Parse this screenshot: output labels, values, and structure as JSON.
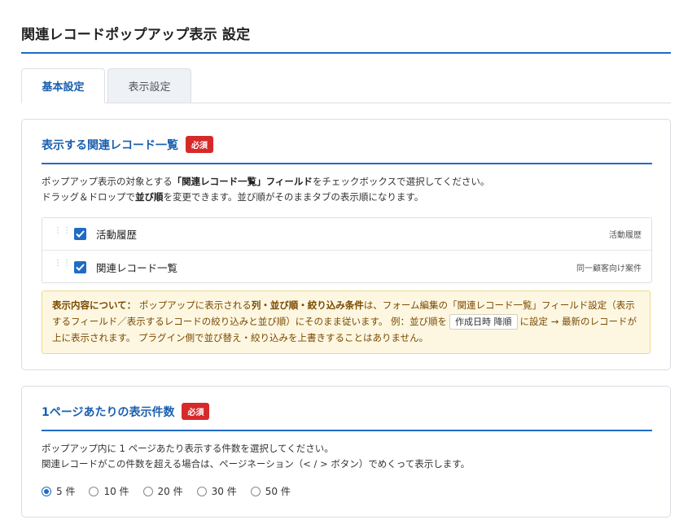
{
  "page": {
    "title": "関連レコードポップアップ表示 設定"
  },
  "tabs": [
    {
      "label": "基本設定",
      "active": true
    },
    {
      "label": "表示設定",
      "active": false
    }
  ],
  "related_list_section": {
    "title": "表示する関連レコード一覧",
    "required_badge": "必須",
    "desc_line1_pre": "ポップアップ表示の対象とする",
    "desc_line1_bold": "「関連レコード一覧」フィールド",
    "desc_line1_post": "をチェックボックスで選択してください。",
    "desc_line2_pre": "ドラッグ＆ドロップで",
    "desc_line2_bold": "並び順",
    "desc_line2_post": "を変更できます。並び順がそのままタブの表示順になります。",
    "fields": [
      {
        "label": "活動履歴",
        "code": "活動履歴",
        "checked": true
      },
      {
        "label": "関連レコード一覧",
        "code": "同一顧客向け案件",
        "checked": true
      }
    ],
    "notice": {
      "heading": "表示内容について：",
      "text1": "ポップアップに表示される",
      "bold1": "列・並び順・絞り込み条件",
      "text2": "は、フォーム編集の「関連レコード一覧」フィールド設定（表示するフィールド／表示するレコードの絞り込みと並び順）にそのまま従います。 例：並び順を",
      "chip": "作成日時 降順",
      "text3": "に設定 → 最新のレコードが上に表示されます。 プラグイン側で並び替え・絞り込みを上書きすることはありません。"
    }
  },
  "per_page_section": {
    "title": "1ページあたりの表示件数",
    "required_badge": "必須",
    "desc_line1": "ポップアップ内に 1 ページあたり表示する件数を選択してください。",
    "desc_line2": "関連レコードがこの件数を超える場合は、ページネーション（< / > ボタン）でめくって表示します。",
    "options": [
      {
        "label": "5 件",
        "checked": true
      },
      {
        "label": "10 件",
        "checked": false
      },
      {
        "label": "20 件",
        "checked": false
      },
      {
        "label": "30 件",
        "checked": false
      },
      {
        "label": "50 件",
        "checked": false
      }
    ]
  },
  "colors": {
    "accent": "#1f6cc4",
    "badge": "#d62a2a",
    "notice_bg": "#fdf7e2",
    "notice_text": "#7a4a00"
  }
}
